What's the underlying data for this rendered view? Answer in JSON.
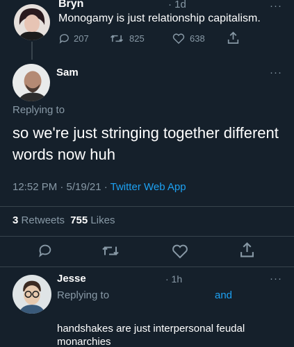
{
  "tweet1": {
    "name": "Bryn",
    "time": "· 1d",
    "text": "Monogamy is just relationship capitalism.",
    "replies": "207",
    "retweets": "825",
    "likes": "638",
    "more": "···",
    "avatar_color": "#d8c2b6"
  },
  "tweet2": {
    "name": "Sam",
    "more": "···",
    "replying_to": "Replying to",
    "text_line1": "so we're just stringing together different",
    "text_line2": "words now huh",
    "time": "12:52 PM · 5/19/21 · ",
    "source": "Twitter Web App",
    "retweet_count": "3",
    "retweet_label": "Retweets",
    "like_count": "755",
    "like_label": "Likes"
  },
  "reply": {
    "name": "Jesse",
    "time": "· 1h",
    "more": "···",
    "replying_to": "Replying to",
    "and": "and",
    "text_line1": "handshakes are just interpersonal feudal",
    "text_line2": "monarchies"
  },
  "colors": {
    "background": "#15202b",
    "secondary": "#8899a6",
    "accent": "#1da1f2",
    "divider": "#38444d"
  },
  "icons": [
    "reply-icon",
    "retweet-icon",
    "like-icon",
    "share-icon"
  ]
}
